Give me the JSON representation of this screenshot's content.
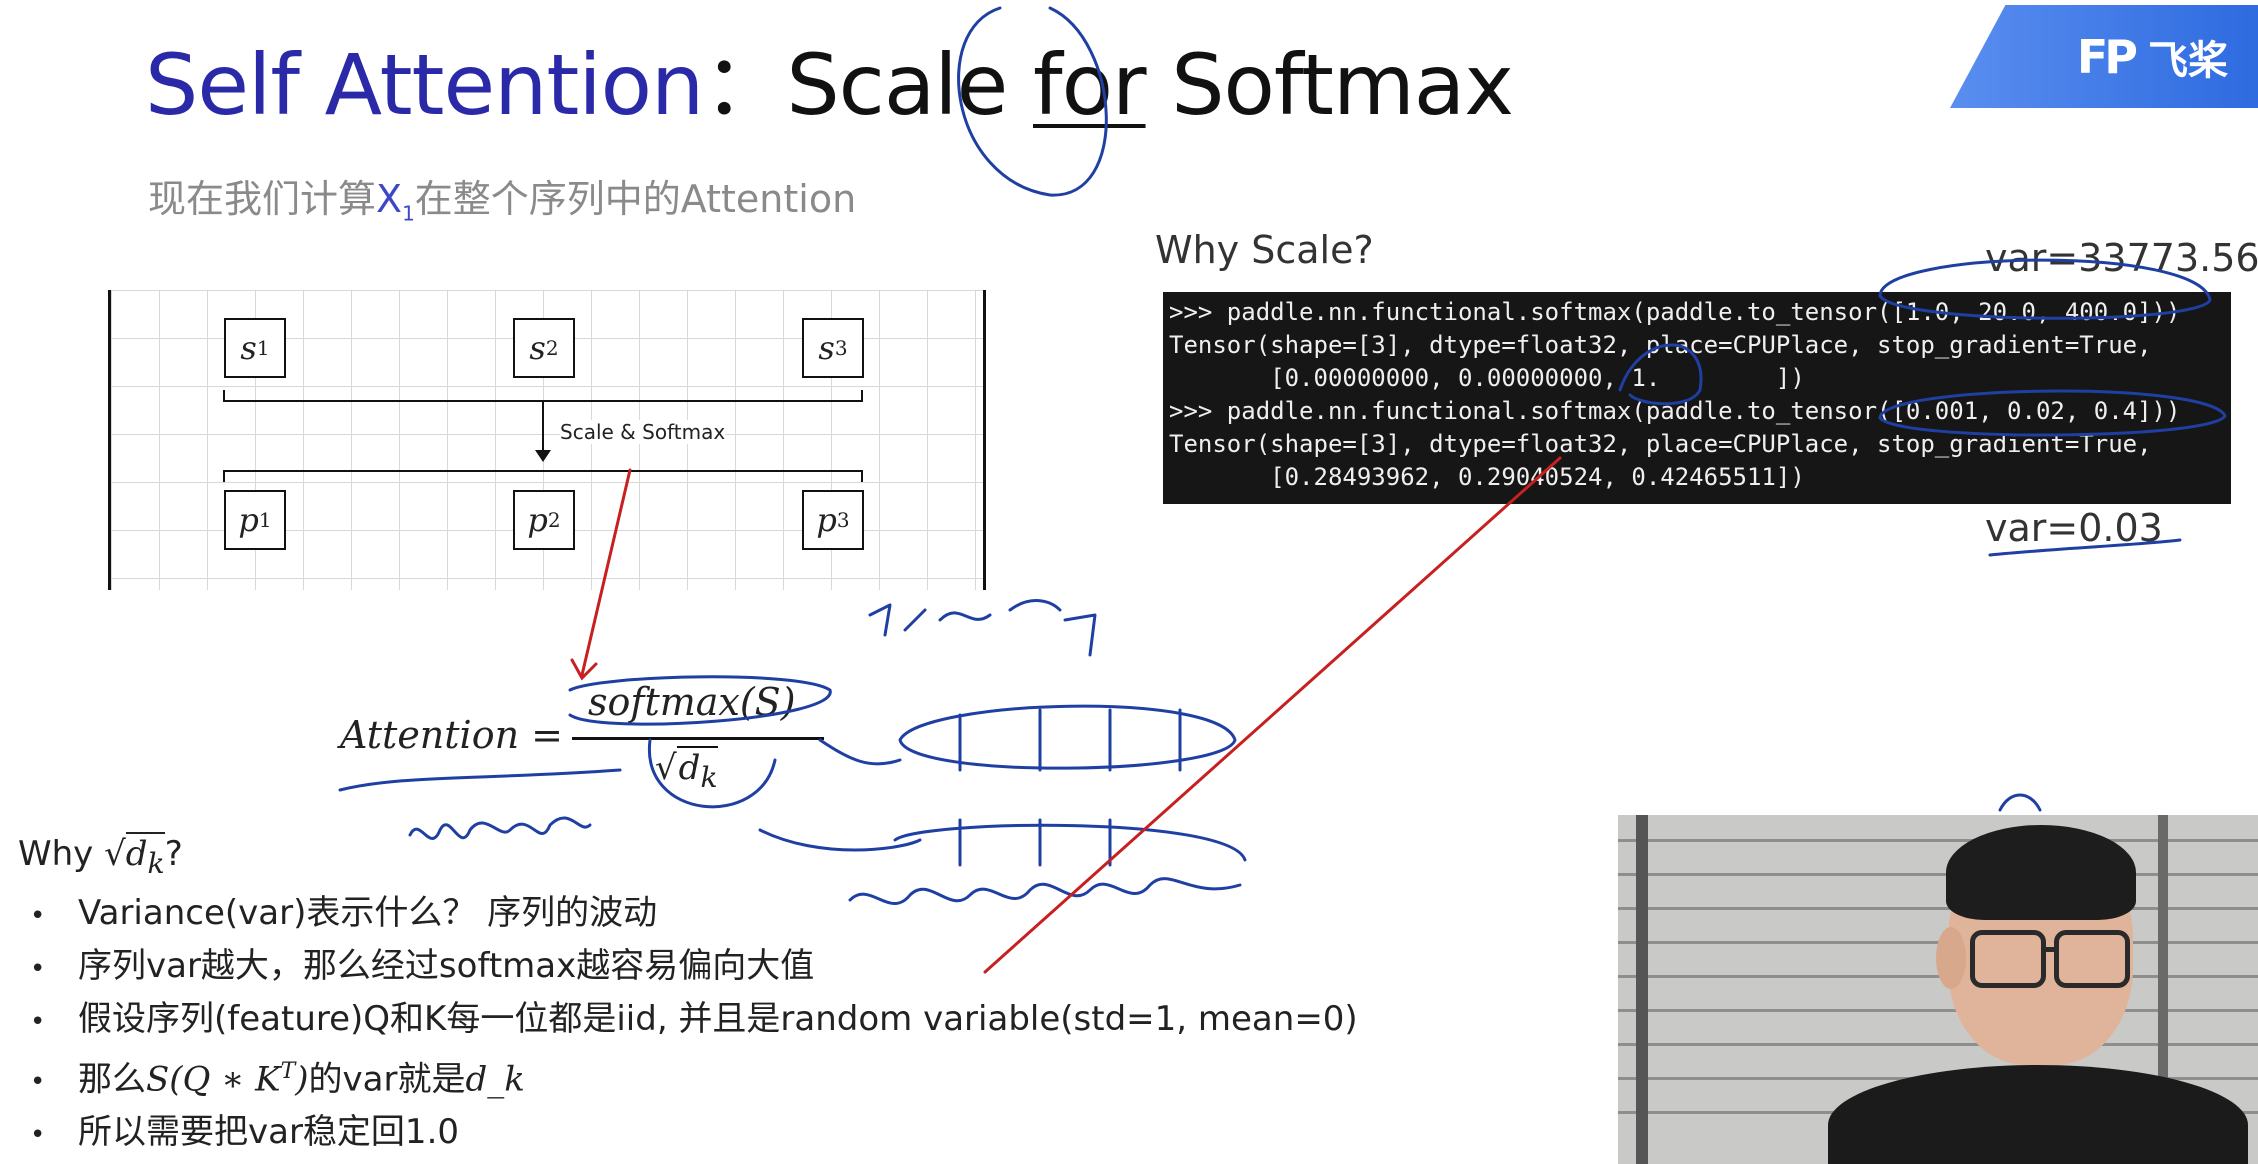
{
  "slide": {
    "title_part1": "Self Attention",
    "title_sep": "：",
    "title_part2": "Scale ",
    "title_underlined": "for",
    "title_part3": " Softmax",
    "logo_mark": "FP",
    "logo_text": "飞桨",
    "subtitle_before": "现在我们计算",
    "subtitle_x": "X",
    "subtitle_sub": "1",
    "subtitle_after": "在整个序列中的Attention"
  },
  "diagram": {
    "s_labels": [
      "s",
      "s",
      "s"
    ],
    "s_indices": [
      "1",
      "2",
      "3"
    ],
    "p_labels": [
      "p",
      "p",
      "p"
    ],
    "p_indices": [
      "1",
      "2",
      "3"
    ],
    "arrow_label": "Scale & Softmax"
  },
  "formula": {
    "lhs": "Attention =",
    "numerator": "softmax(S)",
    "den_sqrt": "√",
    "den_d": "d",
    "den_k": "k"
  },
  "right_panel": {
    "why_scale": "Why Scale?",
    "var_high": "var=33773.56",
    "var_low": "var=0.03",
    "terminal_lines": [
      ">>> paddle.nn.functional.softmax(paddle.to_tensor([1.0, 20.0, 400.0]))",
      "Tensor(shape=[3], dtype=float32, place=CPUPlace, stop_gradient=True,",
      "       [0.00000000, 0.00000000, 1.        ])",
      ">>> paddle.nn.functional.softmax(paddle.to_tensor([0.001, 0.02, 0.4]))",
      "Tensor(shape=[3], dtype=float32, place=CPUPlace, stop_gradient=True,",
      "       [0.28493962, 0.29040524, 0.42465511])"
    ]
  },
  "notes": {
    "why_prefix": "Why ",
    "why_sqrt": "√",
    "why_d": "d",
    "why_k": "k",
    "why_suffix": "?",
    "bullet_symbol": "•",
    "b1": "Variance(var)表示什么？  序列的波动",
    "b2": "序列var越大，那么经过softmax越容易偏向大值",
    "b3": "假设序列(feature)Q和K每一位都是iid, 并且是random variable(std=1, mean=0)",
    "b4_pre": "那么",
    "b4_math": "S(Q ∗ K",
    "b4_sup": "T",
    "b4_close": ")",
    "b4_mid": "的var就是",
    "b4_math2": "d_k",
    "b5": "所以需要把var稳定回1.0"
  },
  "handwriting": {
    "colors": {
      "blue_ink": "#1f3fa3",
      "red_ink": "#c62020"
    }
  }
}
